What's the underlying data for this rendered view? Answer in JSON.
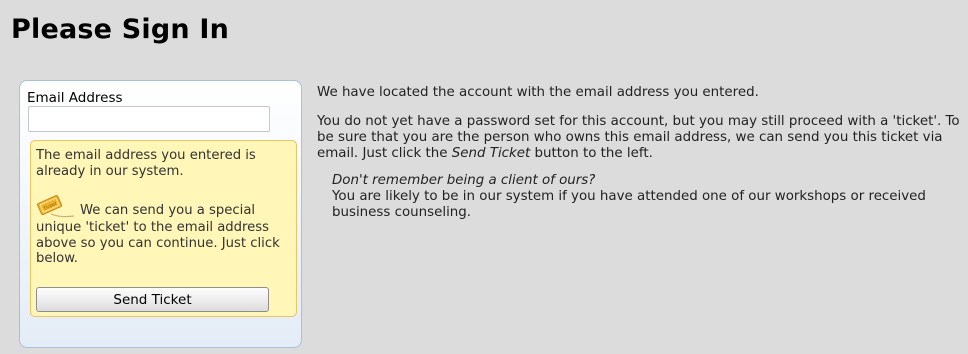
{
  "page": {
    "title": "Please Sign In"
  },
  "signin": {
    "email_label": "Email Address",
    "email_value": "",
    "email_placeholder": "",
    "notice_line1": "The email address you entered is already in our system.",
    "notice_line2": "We can send you a special unique 'ticket' to the email address above so you can continue. Just click below.",
    "ticket_icon_text": "Ticket",
    "send_button_label": "Send Ticket"
  },
  "info": {
    "paragraph1": "We have located the account with the email address you entered.",
    "paragraph2_before": "You do not yet have a password set for this account, but you may still proceed with a 'ticket'. To be sure that you are the person who owns this email address, we can send you this ticket via email. Just click the ",
    "paragraph2_emphasis": "Send Ticket",
    "paragraph2_after": " button to the left.",
    "hint_question": "Don't remember being a client of ours?",
    "hint_answer": "You are likely to be in our system if you have attended one of our workshops or received business counseling."
  },
  "colors": {
    "background": "#dcdcdc",
    "panel_border": "#a9c0dd",
    "notice_background": "#fff6b8",
    "notice_border": "#e8c660",
    "ticket_icon": "#f0b428"
  },
  "icons": {
    "ticket": "ticket-icon"
  }
}
